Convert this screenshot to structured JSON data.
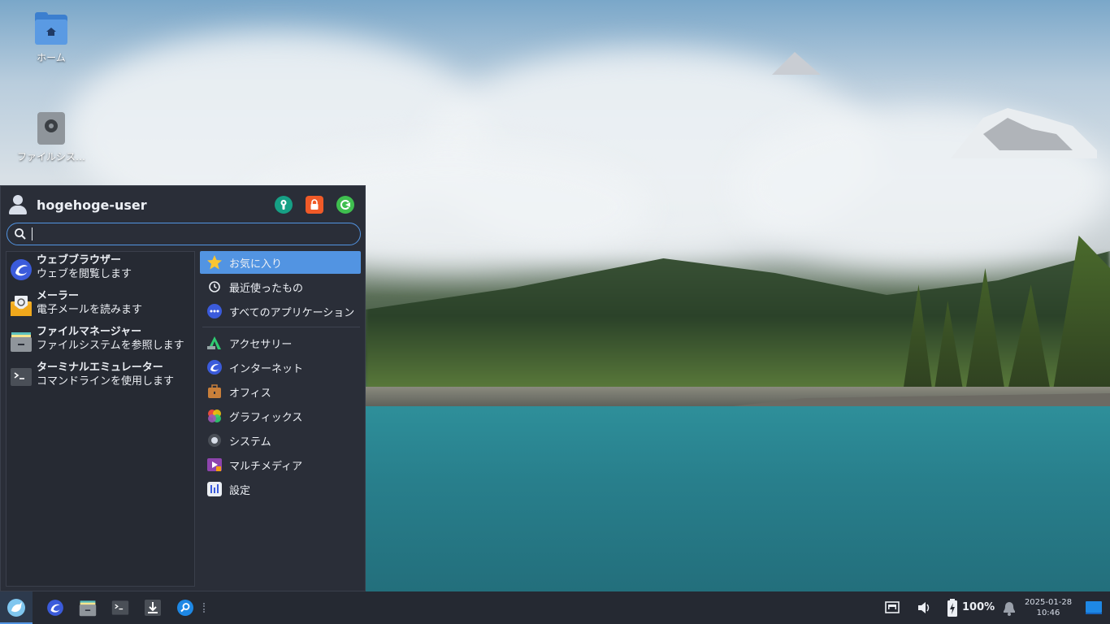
{
  "desktop": {
    "icons": [
      {
        "label": "ホーム",
        "icon": "home-folder-icon"
      },
      {
        "label": "ファイルシス…",
        "icon": "filesystem-drive-icon"
      }
    ]
  },
  "menu": {
    "user": {
      "name": "hogehoge-user",
      "icon": "user-icon"
    },
    "header_buttons": [
      {
        "name": "settings-manager-icon",
        "color": "#16a085"
      },
      {
        "name": "lock-icon",
        "color": "#f05a28"
      },
      {
        "name": "logout-icon",
        "color": "#3fbf4f"
      }
    ],
    "search": {
      "value": "",
      "placeholder": ""
    },
    "favorites": [
      {
        "title": "ウェブブラウザー",
        "subtitle": "ウェブを閲覧します",
        "icon": "web-browser-icon"
      },
      {
        "title": "メーラー",
        "subtitle": "電子メールを読みます",
        "icon": "mail-icon"
      },
      {
        "title": "ファイルマネージャー",
        "subtitle": "ファイルシステムを参照します",
        "icon": "file-manager-icon"
      },
      {
        "title": "ターミナルエミュレーター",
        "subtitle": "コマンドラインを使用します",
        "icon": "terminal-icon"
      }
    ],
    "categories_top": [
      {
        "label": "お気に入り",
        "icon": "star-icon",
        "active": true
      },
      {
        "label": "最近使ったもの",
        "icon": "clock-icon",
        "active": false
      },
      {
        "label": "すべてのアプリケーション",
        "icon": "all-apps-icon",
        "active": false
      }
    ],
    "categories": [
      {
        "label": "アクセサリー",
        "icon": "accessories-icon"
      },
      {
        "label": "インターネット",
        "icon": "internet-icon"
      },
      {
        "label": "オフィス",
        "icon": "office-icon"
      },
      {
        "label": "グラフィックス",
        "icon": "graphics-icon"
      },
      {
        "label": "システム",
        "icon": "system-icon"
      },
      {
        "label": "マルチメディア",
        "icon": "multimedia-icon"
      },
      {
        "label": "設定",
        "icon": "settings-icon"
      }
    ]
  },
  "panel": {
    "launchers": [
      {
        "name": "whisker-menu-icon"
      },
      {
        "name": "web-browser-icon"
      },
      {
        "name": "file-manager-icon"
      },
      {
        "name": "terminal-icon"
      },
      {
        "name": "download-icon"
      },
      {
        "name": "app-finder-icon"
      }
    ],
    "tray": {
      "battery_percent": "100%",
      "date": "2025-01-28",
      "time": "10:46"
    }
  },
  "colors": {
    "accent": "#5294e2",
    "menu_bg": "#2a2e38",
    "panel_bg": "#252932"
  }
}
